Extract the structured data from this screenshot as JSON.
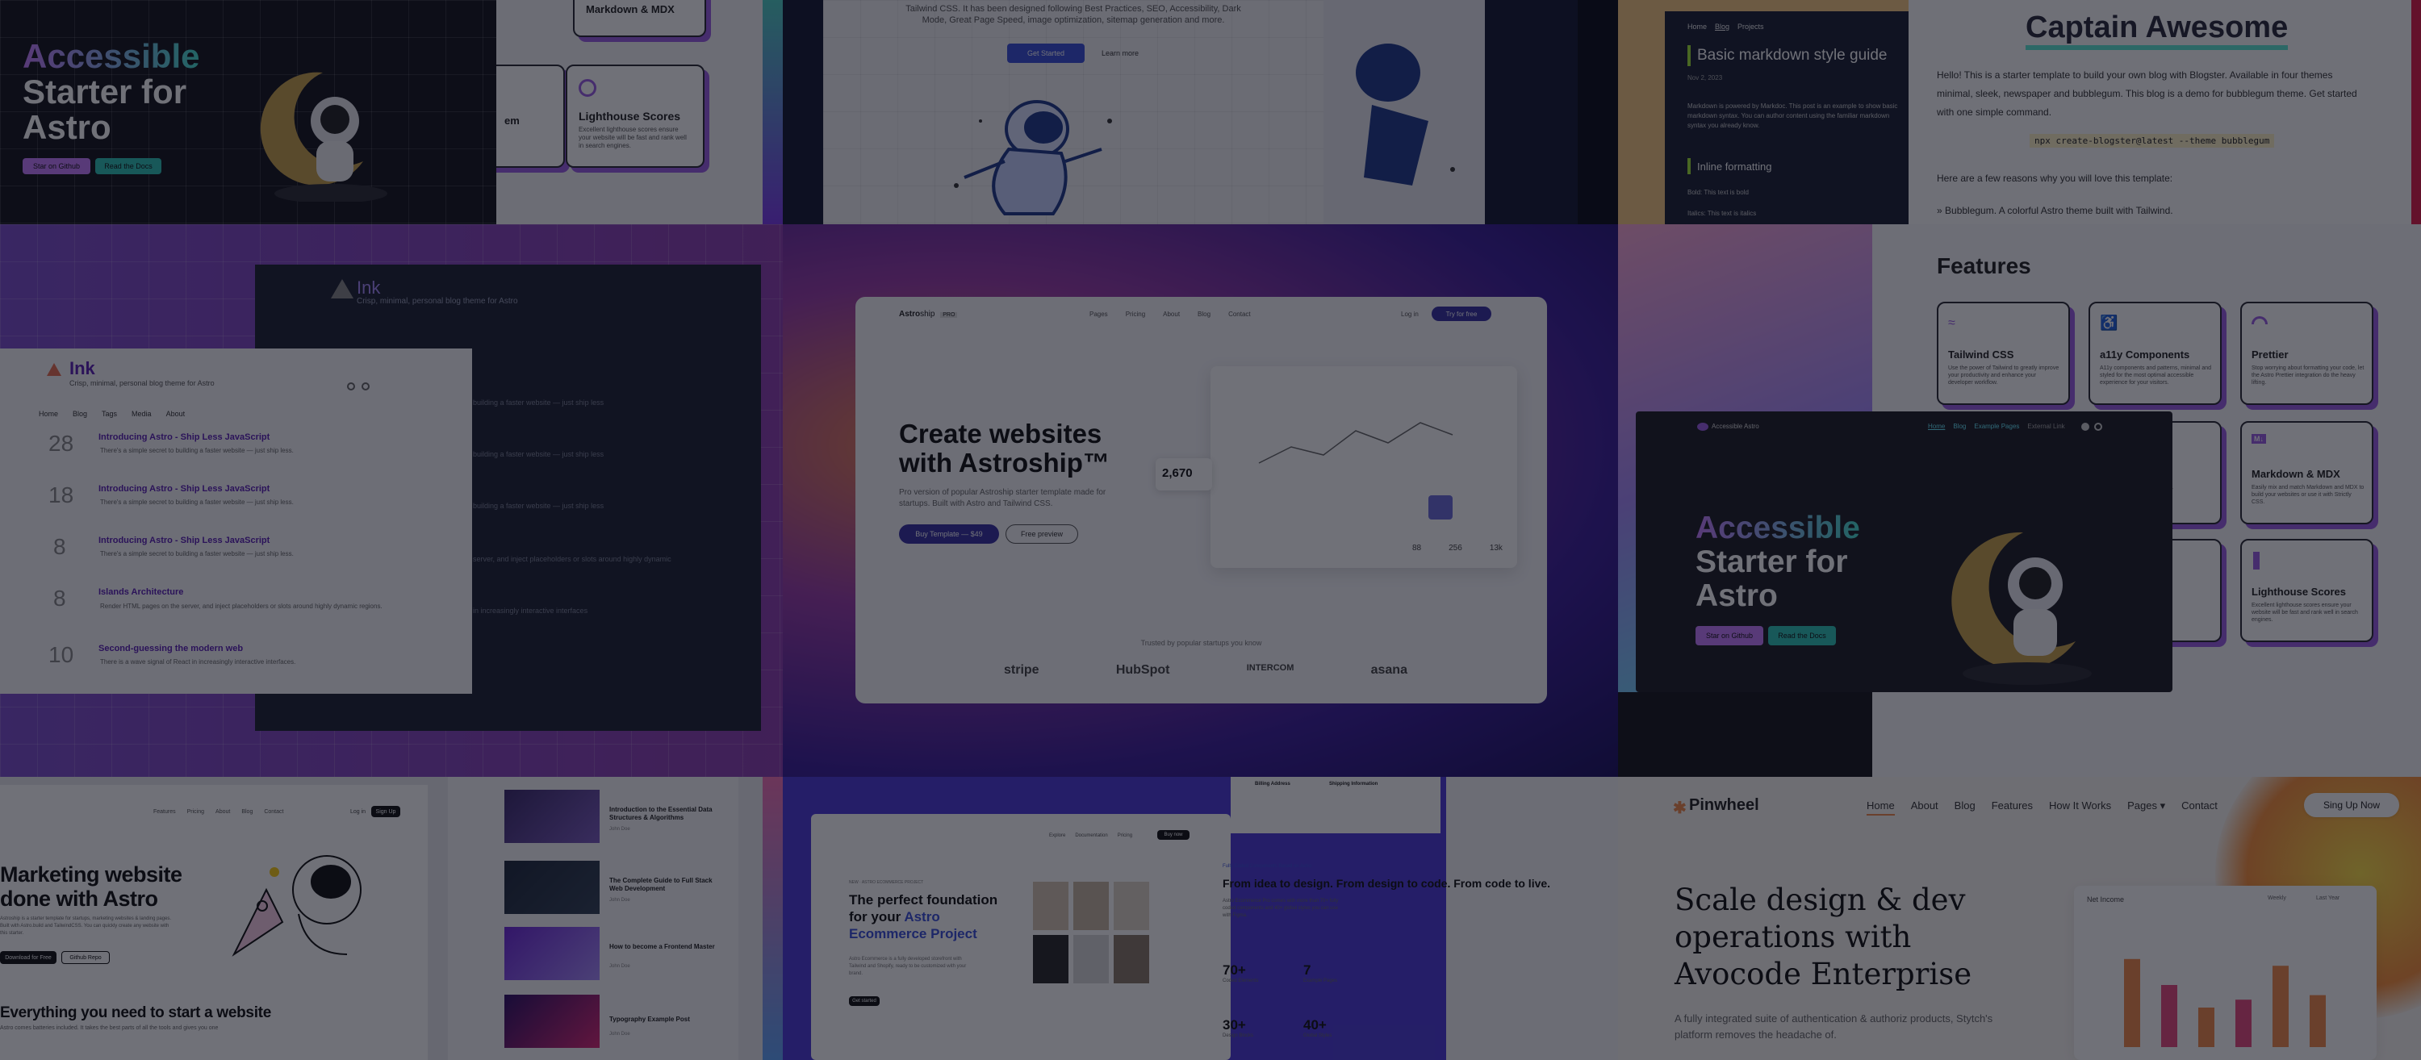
{
  "a11y_small": {
    "title": [
      "Accessible",
      "Starter for",
      "Astro"
    ],
    "buttons": [
      "Star on Github",
      "Read the Docs"
    ]
  },
  "features_top": {
    "cards": [
      {
        "title": "Markdown & MDX",
        "desc": "Easily mix and match Markdown and MDX to build your websites or use it with Strictly CSS."
      },
      {
        "title": "Lighthouse Scores",
        "desc": "Excellent lighthouse scores ensure your website will be fast and rank well in search engines."
      },
      {
        "title": "em",
        "desc": ""
      }
    ]
  },
  "dark_hero": {
    "text": "Tailwind CSS. It has been designed following Best Practices, SEO, Accessibility, Dark Mode, Great Page Speed, image optimization, sitemap generation and more.",
    "buttons": [
      "Get Started",
      "Learn more"
    ]
  },
  "blog_dark": {
    "nav": [
      "Home",
      "Blog",
      "Projects"
    ],
    "title": "Basic markdown style guide",
    "date": "Nov 2, 2023",
    "intro": "Markdown is powered by Markdoc. This post is an example to show basic markdown syntax. You can author content using the familiar markdown syntax you already know.",
    "section": "Inline formatting",
    "lines": [
      "Bold: This text is bold",
      "Italics: This text is italics"
    ]
  },
  "captain": {
    "title": "Captain Awesome",
    "p1": "Hello! This is a starter template to build your own blog with Blogster. Available in four themes minimal, sleek, newspaper and bubblegum. This blog is a demo for bubblegum theme. Get started with one simple command.",
    "cmd": "npx create-blogster@latest --theme bubblegum",
    "p2": "Here are a few reasons why you will love this template:",
    "bullet": "Bubblegum. A colorful Astro theme built with Tailwind."
  },
  "ink": {
    "brand": "Ink",
    "tagline": "Crisp, minimal, personal blog theme for Astro",
    "tagline_small": "Crisp, minimal, personal blog theme for Astro",
    "nav": [
      "Home",
      "Blog",
      "Tags",
      "Media",
      "About"
    ],
    "posts": [
      {
        "day": "28",
        "title": "Introducing Astro - Ship Less JavaScript",
        "desc": "There's a simple secret to building a faster website — just ship less."
      },
      {
        "day": "18",
        "title": "Introducing Astro - Ship Less JavaScript",
        "desc": "There's a simple secret to building a faster website — just ship less."
      },
      {
        "day": "8",
        "title": "Introducing Astro - Ship Less JavaScript",
        "desc": "There's a simple secret to building a faster website — just ship less."
      },
      {
        "day": "8",
        "title": "Islands Architecture",
        "desc": "Render HTML pages on the server, and inject placeholders or slots around highly dynamic regions."
      },
      {
        "day": "10",
        "title": "Second-guessing the modern web",
        "desc": "There is a wave signal of React in increasingly interactive interfaces."
      }
    ],
    "back_lines": [
      "building a faster website — just ship less",
      "building a faster website — just ship less",
      "building a faster website — just ship less",
      "server, and inject placeholders or slots around highly dynamic",
      "in increasingly interactive interfaces"
    ]
  },
  "astroship": {
    "logo": "Astro",
    "logo2": "ship",
    "badge": "PRO",
    "nav": [
      "Pages",
      "Pricing",
      "About",
      "Blog",
      "Contact"
    ],
    "login": "Log in",
    "cta": "Try for free",
    "headline": [
      "Create websites",
      "with Astroship™"
    ],
    "sub": "Pro version of popular Astroship starter template made for startups. Built with Astro and Tailwind CSS.",
    "buy": "Buy Template — $49",
    "preview": "Free preview",
    "trusted": "Trusted by popular startups you know",
    "logos": [
      "stripe",
      "HubSpot",
      "INTERCOM",
      "asana"
    ],
    "stat": "2,670",
    "stats_small": [
      "88",
      "256",
      "13k"
    ]
  },
  "a11y_big": {
    "brand": "Accessible Astro",
    "nav": [
      "Home",
      "Blog",
      "Example Pages",
      "External Link"
    ],
    "title": [
      "Accessible",
      "Starter for",
      "Astro"
    ],
    "buttons": [
      "Star on Github",
      "Read the Docs"
    ]
  },
  "features": {
    "heading": "Features",
    "cards": [
      {
        "title": "Tailwind CSS",
        "desc": "Use the power of Tailwind to greatly improve your productivity and enhance your developer workflow."
      },
      {
        "title": "a11y Components",
        "desc": "A11y components and patterns, minimal and styled for the most optimal accessible experience for your visitors."
      },
      {
        "title": "Prettier",
        "desc": "Stop worrying about formatting your code, let the Astro Prettier integration do the heavy lifting."
      },
      {
        "title": "Markdown & MDX",
        "desc": "Easily mix and match Markdown and MDX to build your websites or use it with Strictly CSS."
      },
      {
        "title": "Lighthouse Scores",
        "desc": "Excellent lighthouse scores ensure your website will be fast and rank well in search engines."
      }
    ],
    "partial": [
      "fully",
      "em"
    ]
  },
  "marketing": {
    "nav": [
      "Features",
      "Pricing",
      "About",
      "Blog",
      "Contact"
    ],
    "login": "Log in",
    "signup": "Sign Up",
    "headline": [
      "Marketing website",
      "done with Astro"
    ],
    "sub": "Astroship is a starter template for startups, marketing websites & landing pages. Built with Astro.build and TailwindCSS. You can quickly create any website with this starter.",
    "buttons": [
      "Download for Free",
      "Github Repo"
    ],
    "section": "Everything you need to start a website",
    "section_sub": "Astro comes batteries included. It takes the best parts of all the tools and gives you one"
  },
  "course": {
    "items": [
      {
        "title": "Introduction to the Essential Data Structures & Algorithms",
        "meta": "John Doe"
      },
      {
        "title": "The Complete Guide to Full Stack Web Development",
        "meta": "John Doe"
      },
      {
        "title": "How to become a Frontend Master",
        "meta": "John Doe"
      },
      {
        "title": "Typography Example Post",
        "meta": "John Doe"
      }
    ]
  },
  "ecom": {
    "breadcrumb": "NEW · ASTRO ECOMMERCE PROJECT",
    "headline": [
      "The perfect foundation",
      "for your"
    ],
    "highlight": "Astro",
    "highlight2": "Ecommerce Project",
    "sub": "Astro Ecommerce is a fully developed storefront with Tailwind and Shopify, ready to be customized with your brand.",
    "button": "Get started",
    "nav": [
      "Explore",
      "Documentation",
      "Pricing"
    ],
    "buy": "Buy now"
  },
  "idea": {
    "eyebrow": "Fully Coded Components Based on Astro",
    "headline": "From idea to design. From design to code. From code to live.",
    "sub": "Astro Ecommerce Pro comes with more than 70+ fully coded components and 40+ global styles you can use with Figma.",
    "stats": [
      {
        "num": "70+",
        "label": "Coded Elements"
      },
      {
        "num": "7",
        "label": "Example Pages"
      },
      {
        "num": "30+",
        "label": "Design Blocks"
      },
      {
        "num": "40+",
        "label": "Global Styles"
      }
    ],
    "billing": "Billing Address",
    "shipping": "Shipping Information"
  },
  "pinwheel": {
    "brand": "Pinwheel",
    "nav": [
      "Home",
      "About",
      "Blog",
      "Features",
      "How It Works",
      "Pages",
      "Contact"
    ],
    "cta": "Sing Up Now",
    "headline": [
      "Scale design & dev",
      "operations with",
      "Avocode Enterprise"
    ],
    "sub": [
      "A fully integrated suite of authentication & authoriz products, Stytch's",
      "platform removes the headache of."
    ],
    "chart_title": "Net Income",
    "chart_filter1": "Weekly",
    "chart_filter2": "Last Year"
  },
  "pinwheel_bars": [
    {
      "v": 0.78,
      "c": "#f08a4b"
    },
    {
      "v": 0.55,
      "c": "#e84a7f"
    },
    {
      "v": 0.35,
      "c": "#f08a4b"
    },
    {
      "v": 0.42,
      "c": "#e84a7f"
    },
    {
      "v": 0.72,
      "c": "#f08a4b"
    },
    {
      "v": 0.46,
      "c": "#f08a4b"
    }
  ],
  "colors": {
    "brand_purple": "#9b5de5",
    "teal": "#2ec4b6",
    "pinwheel_orange": "#f08a4b",
    "astroship_blue": "#3730a3"
  }
}
